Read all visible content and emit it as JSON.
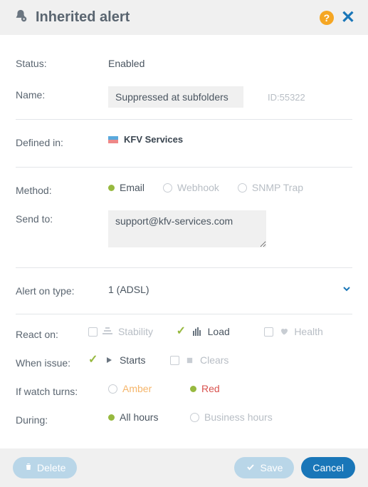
{
  "dialog": {
    "title": "Inherited alert"
  },
  "fields": {
    "status_label": "Status:",
    "status_value": "Enabled",
    "name_label": "Name:",
    "name_value": "Suppressed at subfolders",
    "id_text": "ID:55322",
    "defined_label": "Defined in:",
    "defined_value": "KFV Services",
    "method_label": "Method:",
    "methods": {
      "email": "Email",
      "webhook": "Webhook",
      "snmp": "SNMP Trap"
    },
    "sendto_label": "Send to:",
    "sendto_value": "support@kfv-services.com",
    "alerttype_label": "Alert on type:",
    "alerttype_value": "1 (ADSL)",
    "react_label": "React on:",
    "react": {
      "stability": "Stability",
      "load": "Load",
      "health": "Health"
    },
    "when_label": "When issue:",
    "when": {
      "starts": "Starts",
      "clears": "Clears"
    },
    "watch_label": "If watch turns:",
    "watch": {
      "amber": "Amber",
      "red": "Red"
    },
    "during_label": "During:",
    "during": {
      "all": "All hours",
      "business": "Business hours"
    }
  },
  "buttons": {
    "delete": "Delete",
    "save": "Save",
    "cancel": "Cancel"
  }
}
